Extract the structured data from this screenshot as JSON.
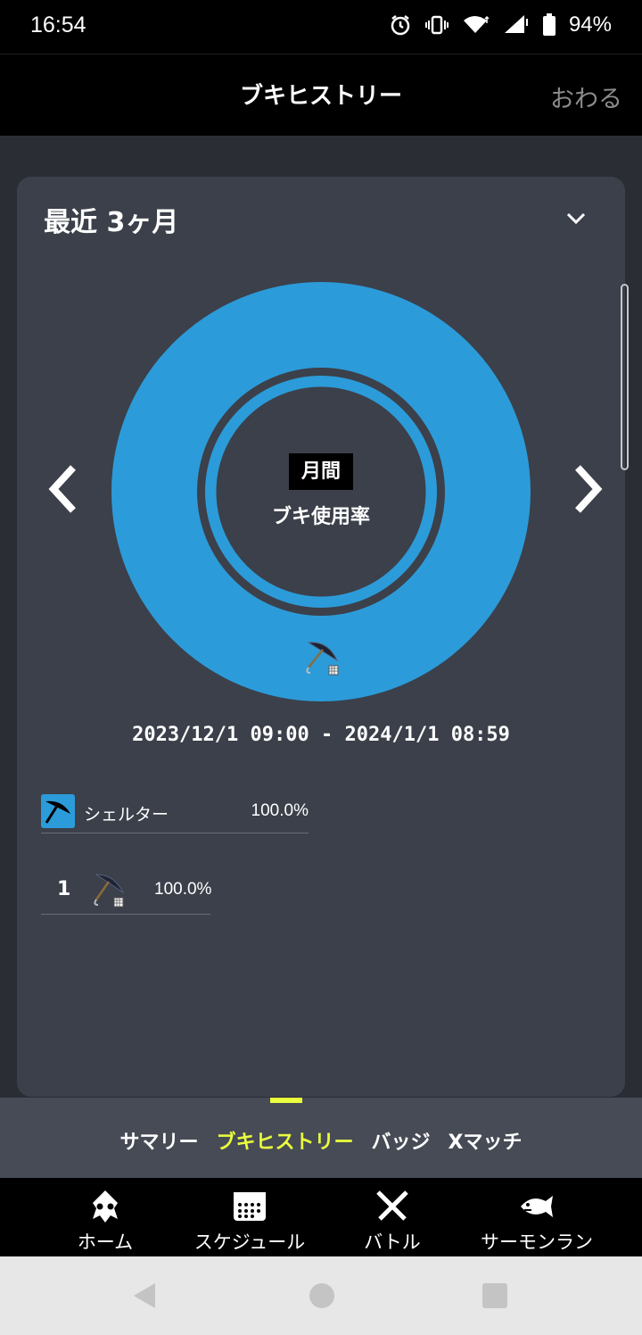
{
  "status_bar": {
    "time": "16:54",
    "battery": "94%"
  },
  "header": {
    "title": "ブキヒストリー",
    "close_label": "おわる"
  },
  "card": {
    "period_title": "最近 3ヶ月",
    "donut_box_label": "月間",
    "donut_label": "ブキ使用率",
    "date_range": "2023/12/1 09:00 - 2024/1/1 08:59",
    "legend": [
      {
        "name": "シェルター",
        "percent": "100.0%"
      }
    ],
    "ranking": [
      {
        "rank": "1",
        "percent": "100.0%"
      }
    ]
  },
  "chart_data": {
    "type": "pie",
    "title": "",
    "categories": [
      "シェルター"
    ],
    "values": [
      100.0
    ],
    "colors": [
      "#2c9bd9"
    ]
  },
  "subnav": {
    "tabs": [
      {
        "label": "サマリー",
        "active": false
      },
      {
        "label": "ブキヒストリー",
        "active": true
      },
      {
        "label": "バッジ",
        "active": false
      },
      {
        "label": "Xマッチ",
        "active": false
      }
    ]
  },
  "bottom_nav": {
    "items": [
      {
        "label": "ホーム",
        "icon": "squid-icon"
      },
      {
        "label": "スケジュール",
        "icon": "calendar-icon"
      },
      {
        "label": "バトル",
        "icon": "crossed-weapons-icon"
      },
      {
        "label": "サーモンラン",
        "icon": "salmon-icon"
      }
    ]
  },
  "colors": {
    "accent": "#eaff3d",
    "donut": "#2c9bd9",
    "card_bg": "#3b404a"
  }
}
